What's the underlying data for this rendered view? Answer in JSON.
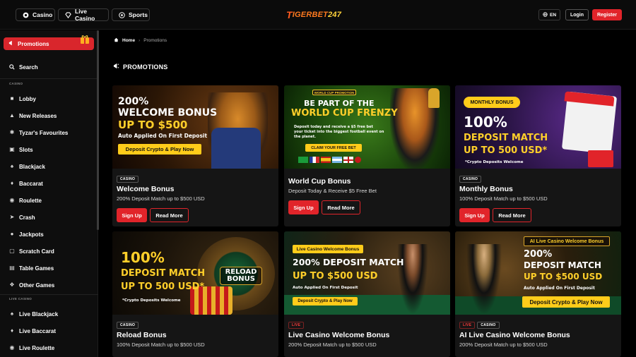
{
  "topbar": {
    "nav": [
      {
        "label": "Casino",
        "icon": "casino-chip-icon"
      },
      {
        "label": "Live Casino",
        "icon": "diamond-icon"
      },
      {
        "label": "Sports",
        "icon": "soccer-ball-icon"
      }
    ],
    "logo": {
      "prefix": "T",
      "name": "IGERBET",
      "num": "247"
    },
    "lang_label": "EN",
    "login_label": "Login",
    "register_label": "Register"
  },
  "sidebar": {
    "promotions_label": "Promotions",
    "search_label": "Search",
    "casino_section": "CASINO",
    "casino_items": [
      {
        "label": "Lobby",
        "icon": "lobby-icon"
      },
      {
        "label": "New Releases",
        "icon": "new-releases-icon"
      },
      {
        "label": "Tyzar's Favourites",
        "icon": "tiger-icon"
      },
      {
        "label": "Slots",
        "icon": "slots-icon"
      },
      {
        "label": "Blackjack",
        "icon": "cards-icon"
      },
      {
        "label": "Baccarat",
        "icon": "baccarat-icon"
      },
      {
        "label": "Roulette",
        "icon": "roulette-icon"
      },
      {
        "label": "Crash",
        "icon": "rocket-icon"
      },
      {
        "label": "Jackpots",
        "icon": "jackpot-icon"
      },
      {
        "label": "Scratch Card",
        "icon": "scratch-card-icon"
      },
      {
        "label": "Table Games",
        "icon": "table-games-icon"
      },
      {
        "label": "Other Games",
        "icon": "other-games-icon"
      }
    ],
    "live_section": "LIVE CASINO",
    "live_items": [
      {
        "label": "Live Blackjack",
        "icon": "cards-icon"
      },
      {
        "label": "Live Baccarat",
        "icon": "baccarat-icon"
      },
      {
        "label": "Live Roulette",
        "icon": "roulette-icon"
      }
    ]
  },
  "breadcrumb": {
    "home": "Home",
    "current": "Promotions"
  },
  "page_title": "PROMOTIONS",
  "cards": [
    {
      "tags": [
        "CASINO"
      ],
      "title": "Welcome Bonus",
      "desc": "200% Deposit Match up to $500 USD",
      "signup": "Sign Up",
      "more": "Read More",
      "banner": {
        "l1": "200%",
        "l2": "WELCOME BONUS",
        "l3": "UP TO $500",
        "l4": "Auto Applied On First Deposit",
        "cta": "Deposit Crypto & Play Now"
      }
    },
    {
      "tags": [],
      "title": "World Cup Bonus",
      "desc": "Deposit Today & Receive $5 Free Bet",
      "signup": "Sign Up",
      "more": "Read More",
      "banner": {
        "badge": "WORLD CUP PROMOTION",
        "l1": "BE PART OF THE",
        "l2": "WORLD CUP FRENZY",
        "l3": "Deposit today and receive a $5 free bet",
        "l4": "your ticket into the biggest football event on",
        "l5": "the planet.",
        "cta": "CLAIM YOUR FREE BET"
      }
    },
    {
      "tags": [
        "CASINO"
      ],
      "title": "Monthly Bonus",
      "desc": "100% Deposit Match up to $500 USD",
      "signup": "Sign Up",
      "more": "Read More",
      "banner": {
        "badge": "MONTHLY BONUS",
        "l1": "100%",
        "l2": "DEPOSIT MATCH",
        "l3": "UP TO 500 USD*",
        "l4": "*Crypto Deposits Welcome"
      }
    },
    {
      "tags": [
        "CASINO"
      ],
      "title": "Reload Bonus",
      "desc": "100% Deposit Match up to $500 USD",
      "banner": {
        "l1": "100%",
        "l2": "DEPOSIT MATCH",
        "l3": "UP TO 500 USD*",
        "l4": "*Crypto Deposits Welcome",
        "wheel": "RELOAD BONUS"
      }
    },
    {
      "tags": [
        "LIVE"
      ],
      "title": "Live Casino Welcome Bonus",
      "desc": "200% Deposit Match up to $500 USD",
      "banner": {
        "badge": "Live Casino Welcome Bonus",
        "l1": "200% DEPOSIT MATCH",
        "l2": "UP TO $500 USD",
        "l3": "Auto Applied On First Deposit",
        "cta": "Deposit Crypto & Play Now"
      }
    },
    {
      "tags": [
        "LIVE",
        "CASINO"
      ],
      "title": "AI Live Casino Welcome Bonus",
      "desc": "200% Deposit Match up to $500 USD",
      "banner": {
        "badge": "AI Live Casino Welcome Bonus",
        "l1": "200%",
        "l2": "DEPOSIT MATCH",
        "l3": "UP TO $500 USD",
        "l4": "Auto Applied On First Deposit",
        "cta": "Deposit Crypto & Play Now"
      }
    }
  ],
  "colors": {
    "accent": "#e1242a",
    "gold": "#ffcf2a",
    "bg": "#000000",
    "card": "#151515"
  }
}
